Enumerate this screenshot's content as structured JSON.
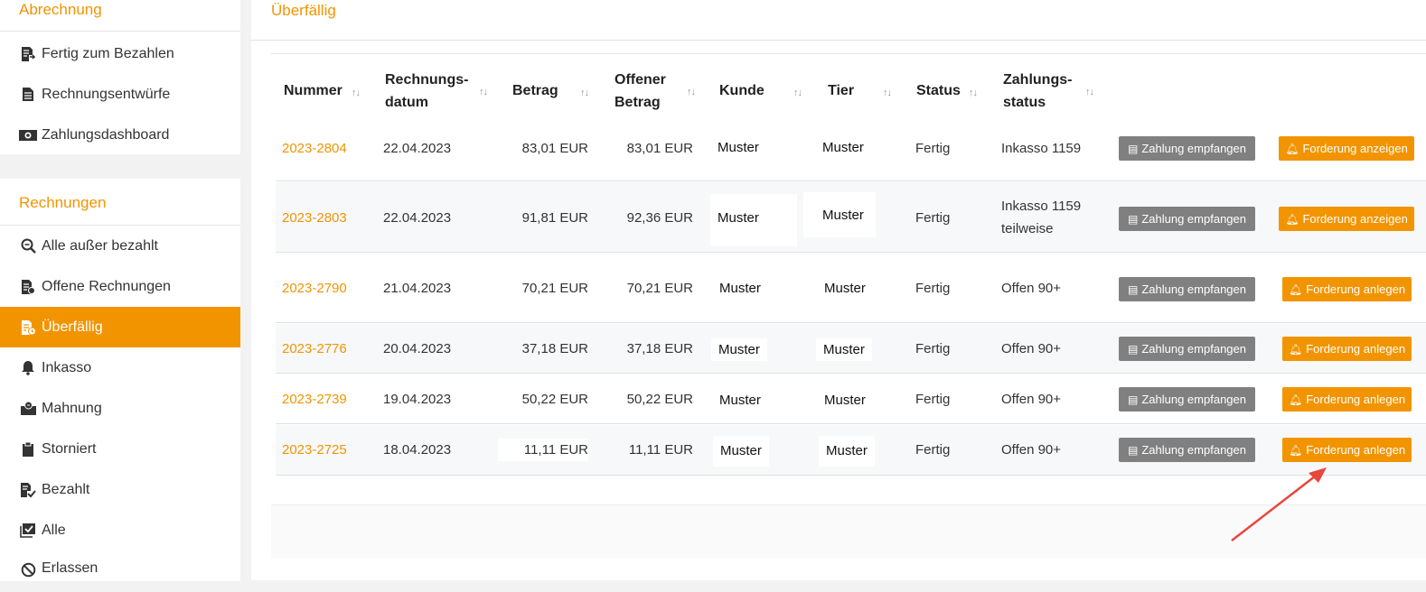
{
  "sidebar": {
    "billing": {
      "title": "Abrechnung",
      "items": [
        {
          "label": "Fertig zum Bezahlen",
          "icon": "invoice-ready-icon"
        },
        {
          "label": "Rechnungsentwürfe",
          "icon": "document-draft-icon"
        },
        {
          "label": "Zahlungsdashboard",
          "icon": "money-icon"
        }
      ]
    },
    "invoices": {
      "title": "Rechnungen",
      "items": [
        {
          "label": "Alle außer bezahlt",
          "icon": "search-icon"
        },
        {
          "label": "Offene Rechnungen",
          "icon": "open-invoice-icon"
        },
        {
          "label": "Überfällig",
          "icon": "overdue-icon"
        },
        {
          "label": "Inkasso",
          "icon": "bell-icon"
        },
        {
          "label": "Mahnung",
          "icon": "dunning-icon"
        },
        {
          "label": "Storniert",
          "icon": "clipboard-icon"
        },
        {
          "label": "Bezahlt",
          "icon": "paid-icon"
        },
        {
          "label": "Alle",
          "icon": "checkbox-icon"
        },
        {
          "label": "Erlassen",
          "icon": "ban-icon"
        }
      ]
    }
  },
  "main": {
    "title": "Überfällig",
    "columns": {
      "number": "Nummer",
      "date1": "Rechnungs-",
      "date2": "datum",
      "amount": "Betrag",
      "open1": "Offener",
      "open2": "Betrag",
      "customer": "Kunde",
      "tier": "Tier",
      "status": "Status",
      "pay1": "Zahlungs-",
      "pay2": "status",
      "sort": "↑↓"
    },
    "rows": [
      {
        "number": "2023-2804",
        "date": "22.04.2023",
        "amount": "83,01 EUR",
        "open": "83,01 EUR",
        "customer": "Muster",
        "tier": "Muster",
        "status": "Fertig",
        "pay1": "Inkasso 1159",
        "pay2": "",
        "btn1": "Zahlung empfangen",
        "btn2": "Forderung anzeigen"
      },
      {
        "number": "2023-2803",
        "date": "22.04.2023",
        "amount": "91,81 EUR",
        "open": "92,36 EUR",
        "customer": "Muster",
        "tier": "Muster",
        "status": "Fertig",
        "pay1": "Inkasso 1159",
        "pay2": "teilweise",
        "btn1": "Zahlung empfangen",
        "btn2": "Forderung anzeigen"
      },
      {
        "number": "2023-2790",
        "date": "21.04.2023",
        "amount": "70,21 EUR",
        "open": "70,21 EUR",
        "customer": "Muster",
        "tier": "Muster",
        "status": "Fertig",
        "pay1": "Offen 90+",
        "pay2": "",
        "btn1": "Zahlung empfangen",
        "btn2": "Forderung anlegen"
      },
      {
        "number": "2023-2776",
        "date": "20.04.2023",
        "amount": "37,18 EUR",
        "open": "37,18 EUR",
        "customer": "Muster",
        "tier": "Muster",
        "status": "Fertig",
        "pay1": "Offen 90+",
        "pay2": "",
        "btn1": "Zahlung empfangen",
        "btn2": "Forderung anlegen"
      },
      {
        "number": "2023-2739",
        "date": "19.04.2023",
        "amount": "50,22 EUR",
        "open": "50,22 EUR",
        "customer": "Muster",
        "tier": "Muster",
        "status": "Fertig",
        "pay1": "Offen 90+",
        "pay2": "",
        "btn1": "Zahlung empfangen",
        "btn2": "Forderung anlegen"
      },
      {
        "number": "2023-2725",
        "date": "18.04.2023",
        "amount": "11,11 EUR",
        "open": "11,11 EUR",
        "customer": "Muster",
        "tier": "Muster",
        "status": "Fertig",
        "pay1": "Offen 90+",
        "pay2": "",
        "btn1": "Zahlung empfangen",
        "btn2": "Forderung anlegen"
      }
    ]
  },
  "colors": {
    "accent": "#f29400",
    "grey_button": "#808080",
    "annotation_arrow": "#e8473a"
  }
}
